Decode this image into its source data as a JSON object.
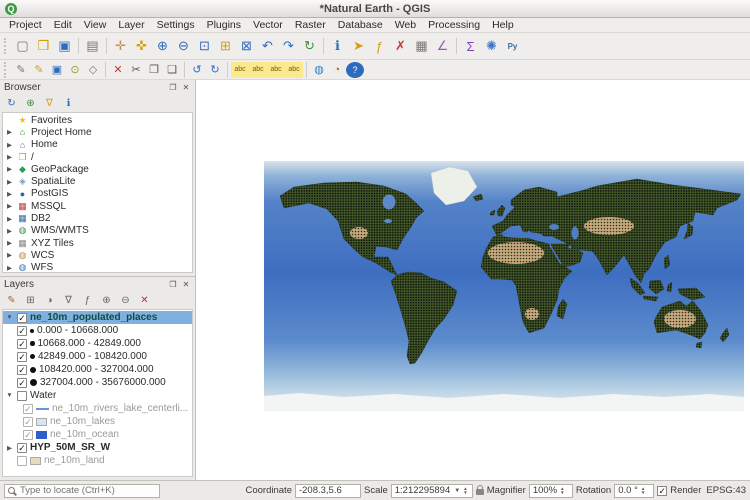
{
  "window": {
    "title": "*Natural Earth - QGIS",
    "logo_glyph": "Q"
  },
  "menu": {
    "items": [
      "Project",
      "Edit",
      "View",
      "Layer",
      "Settings",
      "Plugins",
      "Vector",
      "Raster",
      "Database",
      "Web",
      "Processing",
      "Help"
    ]
  },
  "toolbar1": {
    "icons": [
      {
        "name": "new-project",
        "glyph": "▢",
        "style": "color:#777"
      },
      {
        "name": "open-project",
        "glyph": "❒",
        "style": "color:#d79b00"
      },
      {
        "name": "save-project",
        "glyph": "▣",
        "style": "color:#2d6bbf"
      },
      {
        "name": "layout-manager",
        "glyph": "▤",
        "style": "color:#777"
      },
      {
        "name": "pan-map",
        "glyph": "✛",
        "style": "color:#c98a4b"
      },
      {
        "name": "pan-to-selection",
        "glyph": "✜",
        "style": "color:#d4a017"
      },
      {
        "name": "zoom-in",
        "glyph": "⊕",
        "style": "color:#2d6bbf"
      },
      {
        "name": "zoom-out",
        "glyph": "⊖",
        "style": "color:#2d6bbf"
      },
      {
        "name": "zoom-full",
        "glyph": "⊡",
        "style": "color:#2d6bbf"
      },
      {
        "name": "zoom-to-selection",
        "glyph": "⊞",
        "style": "color:#d4a017"
      },
      {
        "name": "zoom-to-layer",
        "glyph": "⊠",
        "style": "color:#2d6bbf"
      },
      {
        "name": "zoom-last",
        "glyph": "↶",
        "style": "color:#2d6bbf"
      },
      {
        "name": "zoom-next",
        "glyph": "↷",
        "style": "color:#2d6bbf"
      },
      {
        "name": "map-refresh",
        "glyph": "↻",
        "style": "color:#3f8f3f"
      },
      {
        "name": "identify-features",
        "glyph": "ℹ",
        "style": "color:#2d6bbf"
      },
      {
        "name": "select-features",
        "glyph": "➤",
        "style": "color:#d4a017"
      },
      {
        "name": "select-by-expression",
        "glyph": "ƒ",
        "style": "color:#d4a017"
      },
      {
        "name": "deselect-features",
        "glyph": "✗",
        "style": "color:#c23b3b"
      },
      {
        "name": "open-attribute-table",
        "glyph": "▦",
        "style": "color:#777"
      },
      {
        "name": "measure-line",
        "glyph": "∠",
        "style": "color:#9b59b6"
      },
      {
        "name": "show-statistical-summary",
        "glyph": "Σ",
        "style": "color:#7d3fbf"
      },
      {
        "name": "processing-toolbox",
        "glyph": "✺",
        "style": "color:#3a76c4"
      },
      {
        "name": "python-console",
        "glyph": "Py",
        "style": "color:#3673a5;font-size:8px;font-weight:bold"
      }
    ]
  },
  "toolbar2": {
    "icons": [
      {
        "name": "current-edits",
        "glyph": "✎",
        "style": "color:#777"
      },
      {
        "name": "toggle-editing",
        "glyph": "✎",
        "style": "color:#d4a017"
      },
      {
        "name": "save-layer-edits",
        "glyph": "▣",
        "style": "color:#2d6bbf"
      },
      {
        "name": "add-feature",
        "glyph": "⊙",
        "style": "color:#98982a"
      },
      {
        "name": "vertex-tool",
        "glyph": "◇",
        "style": "color:#777"
      },
      {
        "name": "delete-selected",
        "glyph": "✕",
        "style": "color:#c23b3b"
      },
      {
        "name": "cut-features",
        "glyph": "✂",
        "style": "color:#555"
      },
      {
        "name": "copy-features",
        "glyph": "❐",
        "style": "color:#555"
      },
      {
        "name": "paste-features",
        "glyph": "❑",
        "style": "color:#555"
      },
      {
        "name": "undo",
        "glyph": "↺",
        "style": "color:#2d6bbf"
      },
      {
        "name": "redo",
        "glyph": "↻",
        "style": "color:#2d6bbf"
      },
      {
        "name": "layer-labeling-options",
        "glyph": "abc",
        "style": "background:#fbe98f;color:#7a5c00;font-size:7px;border-radius:2px"
      },
      {
        "name": "layer-diagram-options",
        "glyph": "abc",
        "style": "background:#fbe98f;color:#7a5c00;font-size:7px;border-radius:2px"
      },
      {
        "name": "highlight-pinned-labels",
        "glyph": "abc",
        "style": "background:#fbe98f;color:#7a5c00;font-size:7px;border-radius:2px"
      },
      {
        "name": "move-label",
        "glyph": "abc",
        "style": "background:#fbe98f;color:#7a5c00;font-size:7px;border-radius:2px"
      },
      {
        "name": "new-3d-map-view",
        "glyph": "◍",
        "style": "color:#2f7fbf"
      },
      {
        "name": "temporal-controller",
        "glyph": "◔",
        "style": "color:#d35400"
      },
      {
        "name": "help-contents",
        "glyph": "?",
        "style": "background:#2d6bbf;color:#fff;border-radius:50%;font-size:9px"
      }
    ]
  },
  "browser": {
    "title": "Browser",
    "toolbar": [
      {
        "name": "refresh",
        "glyph": "↻",
        "style": "color:#2d6bbf"
      },
      {
        "name": "add-selected-layers",
        "glyph": "⊕",
        "style": "color:#3f8f3f"
      },
      {
        "name": "filter-browser",
        "glyph": "∇",
        "style": "color:#d4a017"
      },
      {
        "name": "properties-widget",
        "glyph": "ℹ",
        "style": "color:#2d6bbf"
      }
    ],
    "items": [
      {
        "expander": "",
        "icon": "★",
        "icon_style": "color:#f5c211",
        "label": "Favorites"
      },
      {
        "expander": "▶",
        "icon": "⌂",
        "icon_style": "color:#3f8f3f",
        "label": "Project Home"
      },
      {
        "expander": "▶",
        "icon": "⌂",
        "icon_style": "color:#3a76c4",
        "label": "Home"
      },
      {
        "expander": "▶",
        "icon": "❒",
        "icon_style": "color:#d79b00",
        "label": "/"
      },
      {
        "expander": "▶",
        "icon": "◆",
        "icon_style": "color:#2e9a5b",
        "label": "GeoPackage"
      },
      {
        "expander": "▶",
        "icon": "◈",
        "icon_style": "color:#7a9ec2",
        "label": "SpatiaLite"
      },
      {
        "expander": "▶",
        "icon": "●",
        "icon_style": "color:#336791",
        "label": "PostGIS"
      },
      {
        "expander": "▶",
        "icon": "▦",
        "icon_style": "color:#c23b3b",
        "label": "MSSQL"
      },
      {
        "expander": "▶",
        "icon": "▦",
        "icon_style": "color:#2e6da4",
        "label": "DB2"
      },
      {
        "expander": "▶",
        "icon": "◍",
        "icon_style": "color:#3f8f3f",
        "label": "WMS/WMTS"
      },
      {
        "expander": "▶",
        "icon": "▦",
        "icon_style": "color:#888888",
        "label": "XYZ Tiles"
      },
      {
        "expander": "▶",
        "icon": "◍",
        "icon_style": "color:#c28a3a",
        "label": "WCS"
      },
      {
        "expander": "▶",
        "icon": "◍",
        "icon_style": "color:#3a76c4",
        "label": "WFS"
      }
    ]
  },
  "layers": {
    "title": "Layers",
    "toolbar": [
      {
        "name": "open-layer-styling",
        "glyph": "✎",
        "style": "color:#aa6a2a"
      },
      {
        "name": "add-group",
        "glyph": "⊞",
        "style": "color:#666"
      },
      {
        "name": "manage-map-themes",
        "glyph": "◑",
        "style": "color:#666"
      },
      {
        "name": "filter-legend",
        "glyph": "∇",
        "style": "color:#666"
      },
      {
        "name": "filter-by-expression",
        "glyph": "ƒ",
        "style": "color:#666"
      },
      {
        "name": "expand-all",
        "glyph": "⊕",
        "style": "color:#666"
      },
      {
        "name": "collapse-all",
        "glyph": "⊖",
        "style": "color:#666"
      },
      {
        "name": "remove-layer",
        "glyph": "✕",
        "style": "color:#b33b3b"
      }
    ],
    "rows": [
      {
        "expander": "▼",
        "check": "✓",
        "label": "ne_10m_populated_places"
      },
      {
        "check": "✓",
        "label": "0.000 - 10668.000"
      },
      {
        "check": "✓",
        "label": "10668.000 - 42849.000"
      },
      {
        "check": "✓",
        "label": "42849.000 - 108420.000"
      },
      {
        "check": "✓",
        "label": "108420.000 - 327004.000"
      },
      {
        "check": "✓",
        "label": "327004.000 - 35676000.000"
      },
      {
        "expander": "▼",
        "check": "",
        "label": "Water"
      },
      {
        "check": "✓",
        "label": "ne_10m_rivers_lake_centerli..."
      },
      {
        "check": "✓",
        "label": "ne_10m_lakes"
      },
      {
        "check": "✓",
        "label": "ne_10m_ocean"
      },
      {
        "expander": "▶",
        "check": "✓",
        "label": "HYP_50M_SR_W"
      },
      {
        "expander": "",
        "check": "",
        "label": "ne_10m_land"
      }
    ]
  },
  "panels": {
    "float_glyph": "❐",
    "close_glyph": "✕"
  },
  "statusbar": {
    "locate_placeholder": "Type to locate (Ctrl+K)",
    "coordinate_label": "Coordinate",
    "coordinate_value": "-208.3,5.6",
    "scale_label": "Scale",
    "scale_value": "1:212295894",
    "magnifier_label": "Magnifier",
    "magnifier_value": "100%",
    "rotation_label": "Rotation",
    "rotation_value": "0.0 °",
    "render_label": "Render",
    "render_check": "✓",
    "crs_icon": "◍",
    "crs_label": "EPSG:43"
  },
  "map": {
    "colors": {
      "ocean": "#3e6ec0",
      "land": "#45582c",
      "desert": "#c8a87d",
      "ice": "#edefe9",
      "selection": "#7fb0e0"
    }
  }
}
